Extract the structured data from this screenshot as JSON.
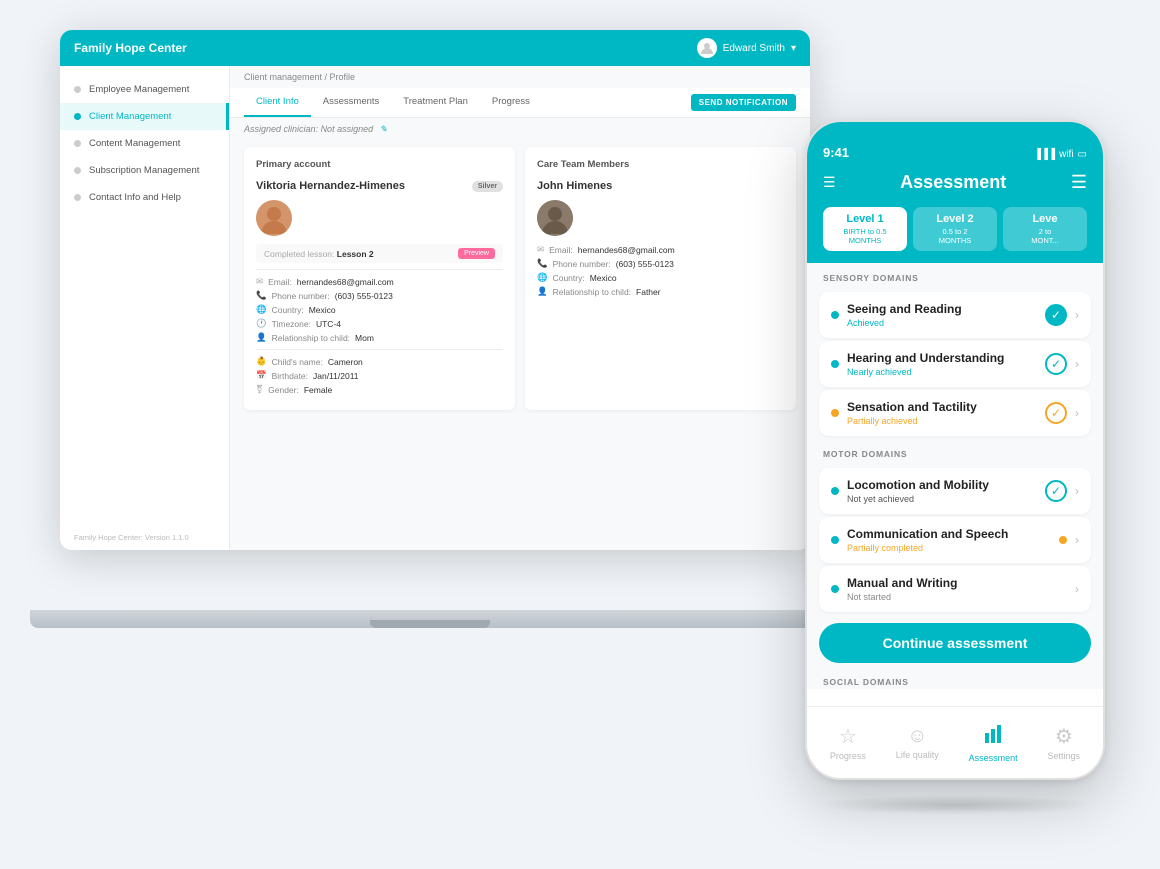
{
  "app": {
    "title": "Family Hope Center",
    "version": "Family Hope Center: Version 1.1.0",
    "user": "Edward Smith"
  },
  "sidebar": {
    "items": [
      {
        "label": "Employee Management",
        "active": false
      },
      {
        "label": "Client Management",
        "active": true
      },
      {
        "label": "Content Management",
        "active": false
      },
      {
        "label": "Subscription Management",
        "active": false
      },
      {
        "label": "Contact Info and Help",
        "active": false
      }
    ]
  },
  "breadcrumb": "Client management / Profile",
  "tabs": [
    {
      "label": "Client Info",
      "active": true
    },
    {
      "label": "Assessments",
      "active": false
    },
    {
      "label": "Treatment Plan",
      "active": false
    },
    {
      "label": "Progress",
      "active": false
    }
  ],
  "send_notification_btn": "SEND NOTIFICATION",
  "assigned_clinician_label": "Assigned clinician:",
  "assigned_clinician_value": "Not assigned",
  "primary_account": {
    "title": "Primary account",
    "client_name": "Viktoria Hernandez-Himenes",
    "badge": "Silver",
    "lesson_label": "Completed lesson:",
    "lesson_value": "Lesson 2",
    "preview_btn": "Preview",
    "email_label": "Email:",
    "email_value": "hernandes68@gmail.com",
    "phone_label": "Phone number:",
    "phone_value": "(603) 555-0123",
    "country_label": "Country:",
    "country_value": "Mexico",
    "timezone_label": "Timezone:",
    "timezone_value": "UTC-4",
    "relationship_label": "Relationship to child:",
    "relationship_value": "Mom",
    "childs_name_label": "Child's name:",
    "childs_name_value": "Cameron",
    "birthdate_label": "Birthdate:",
    "birthdate_value": "Jan/11/2011",
    "gender_label": "Gender:",
    "gender_value": "Female"
  },
  "care_team": {
    "title": "Care Team Members",
    "member_name": "John Himenes",
    "email_label": "Email:",
    "email_value": "hernandes68@gmail.com",
    "phone_label": "Phone number:",
    "phone_value": "(603) 555-0123",
    "country_label": "Country:",
    "country_value": "Mexico",
    "relationship_label": "Relationship to child:",
    "relationship_value": "Father"
  },
  "phone": {
    "time": "9:41",
    "header_title": "Assessment",
    "levels": [
      {
        "label": "Level 1",
        "sub": "BIRTH to 0.5\nMONTHS",
        "active": true
      },
      {
        "label": "Level 2",
        "sub": "0.5 to 2\nMONTHS",
        "active": false
      },
      {
        "label": "Level",
        "sub": "2 to\nMONT...",
        "active": false
      }
    ],
    "sensory_domains_title": "SENSORY DOMAINS",
    "sensory_domains": [
      {
        "name": "Seeing and Reading",
        "status": "Achieved",
        "status_class": "status-achieved",
        "check": "filled",
        "dot_color": "teal"
      },
      {
        "name": "Hearing and Understanding",
        "status": "Nearly achieved",
        "status_class": "status-nearly",
        "check": "outline",
        "dot_color": "teal"
      },
      {
        "name": "Sensation and Tactility",
        "status": "Partially achieved",
        "status_class": "status-partial-orange",
        "check": "outline-orange",
        "dot_color": "orange"
      }
    ],
    "motor_domains_title": "MOTOR DOMAINS",
    "motor_domains": [
      {
        "name": "Locomotion and Mobility",
        "status": "Not yet achieved",
        "status_class": "status-not-yet",
        "check": "outline",
        "dot_color": "teal"
      },
      {
        "name": "Communication and Speech",
        "status": "Partially completed",
        "status_class": "status-partial-completed",
        "check": "orange-dot",
        "dot_color": "teal"
      },
      {
        "name": "Manual and Writing",
        "status": "Not started",
        "status_class": "status-not-started",
        "check": "none",
        "dot_color": "teal"
      }
    ],
    "continue_btn": "Continue assessment",
    "social_domains_title": "SOCIAL DOMAINS",
    "bottom_nav": [
      {
        "label": "Progress",
        "active": false,
        "icon": "☆"
      },
      {
        "label": "Life quality",
        "active": false,
        "icon": "☺"
      },
      {
        "label": "Assessment",
        "active": true,
        "icon": "📊"
      },
      {
        "label": "Settings",
        "active": false,
        "icon": "⚙"
      }
    ]
  }
}
